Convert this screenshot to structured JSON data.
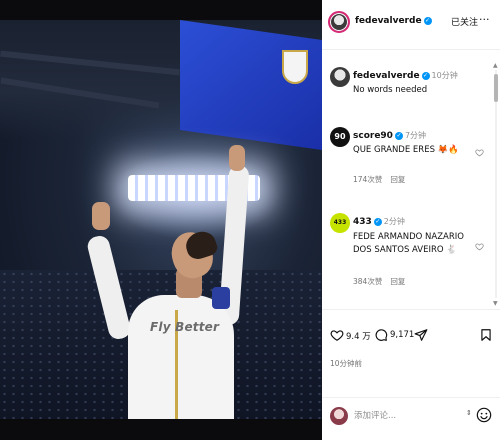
{
  "post": {
    "username": "fedevalverde",
    "follow_label": "已关注",
    "more_label": "···",
    "caption": {
      "username": "fedevalverde",
      "time": "10分钟",
      "text": "No words needed"
    },
    "photo": {
      "sponsor_text": "Fly Better"
    }
  },
  "comments": [
    {
      "username": "score90",
      "logo_text": "90",
      "time": "7分钟",
      "text": "QUE GRANDE ERES 🦊🔥",
      "likes": "174次赞",
      "reply_label": "回复"
    },
    {
      "username": "433",
      "logo_text": "433",
      "time": "2分钟",
      "text": "FEDE ARMANDO NAZARIO DOS SANTOS AVEIRO 🐇",
      "likes": "384次赞",
      "reply_label": "回复"
    }
  ],
  "actions": {
    "likes_count": "9.4 万",
    "comments_count": "9,171",
    "post_time": "10分钟前"
  },
  "comment_bar": {
    "placeholder": "添加评论..."
  },
  "icons": {
    "like": "heart-icon",
    "comment": "speech-bubble-icon",
    "share": "paper-plane-icon",
    "save": "bookmark-icon",
    "emoji": "smiley-icon",
    "verified": "verified-badge-icon"
  },
  "colors": {
    "verified_blue": "#0095f6",
    "story_ring": "#d62976",
    "muted_text": "#737373",
    "logo_433": "#c6e300"
  }
}
